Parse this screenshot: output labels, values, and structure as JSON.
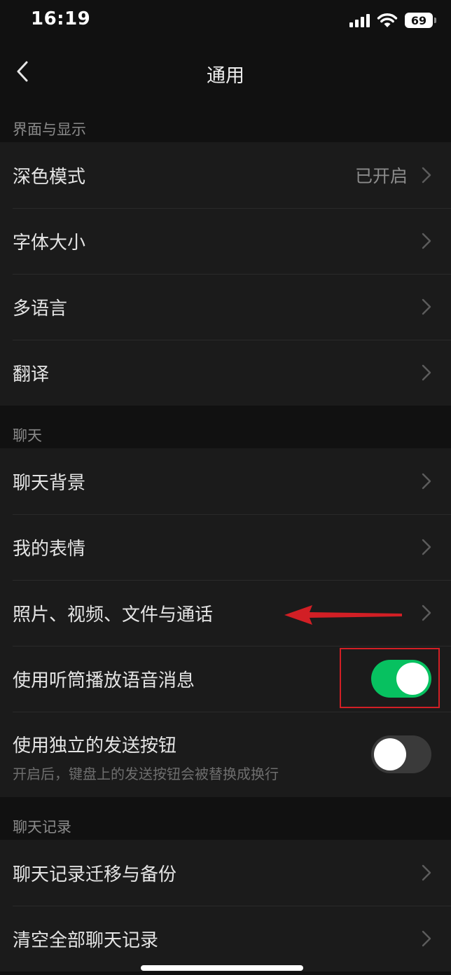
{
  "status_bar": {
    "time": "16:19",
    "battery": "69",
    "icons": [
      "signal-icon",
      "wifi-icon",
      "battery-icon"
    ]
  },
  "nav": {
    "title": "通用",
    "back_icon": "chevron-left-icon"
  },
  "sections": [
    {
      "header": "界面与显示",
      "items": [
        {
          "label": "深色模式",
          "value": "已开启"
        },
        {
          "label": "字体大小"
        },
        {
          "label": "多语言"
        },
        {
          "label": "翻译"
        }
      ]
    },
    {
      "header": "聊天",
      "items": [
        {
          "label": "聊天背景"
        },
        {
          "label": "我的表情"
        },
        {
          "label": "照片、视频、文件与通话"
        },
        {
          "label": "使用听筒播放语音消息",
          "toggle": true
        },
        {
          "label": "使用独立的发送按钮",
          "sublabel": "开启后，键盘上的发送按钮会被替换成换行",
          "toggle": false
        }
      ]
    },
    {
      "header": "聊天记录",
      "items": [
        {
          "label": "聊天记录迁移与备份"
        },
        {
          "label": "清空全部聊天记录"
        }
      ]
    }
  ],
  "colors": {
    "background": "#111111",
    "row_background": "#1b1b1b",
    "toggle_on": "#07c160",
    "annotation": "#d21f25"
  }
}
